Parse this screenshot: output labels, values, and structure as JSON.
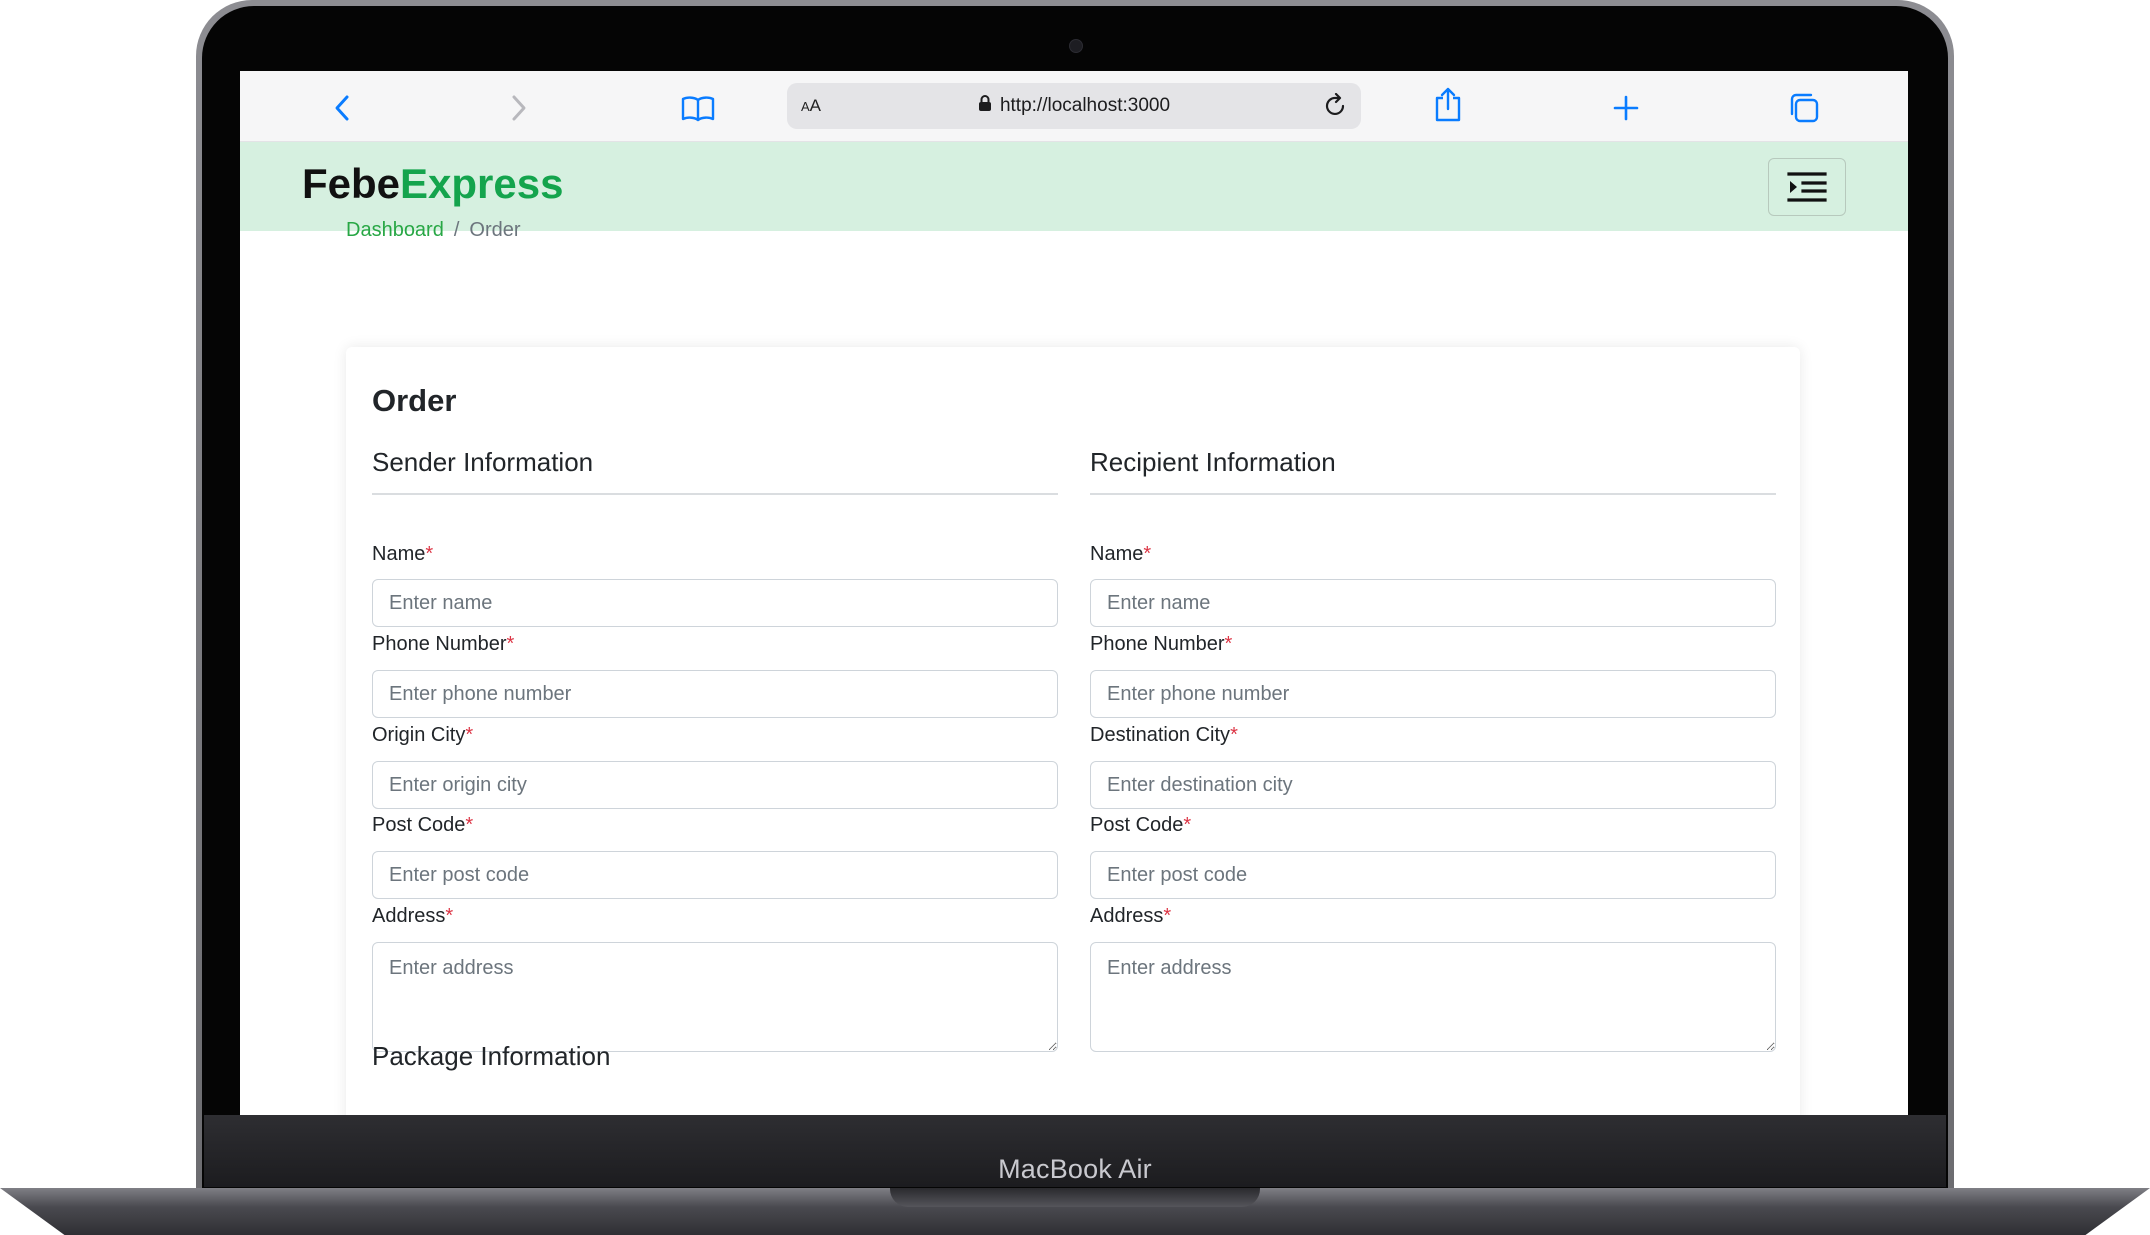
{
  "browser": {
    "text_size_button": "AA",
    "url": "http://localhost:3000"
  },
  "app": {
    "logo_prefix": "Febe",
    "logo_accent": "Express",
    "accent_color": "#14a44d",
    "header_bg": "#d6f0e0"
  },
  "breadcrumb": {
    "items": [
      "Dashboard",
      "Order"
    ],
    "separator": "/"
  },
  "page": {
    "title": "Order"
  },
  "sender": {
    "title": "Sender Information",
    "fields": [
      {
        "label": "Name",
        "required": "*",
        "placeholder": "Enter name",
        "value": ""
      },
      {
        "label": "Phone Number",
        "required": "*",
        "placeholder": "Enter phone number",
        "value": ""
      },
      {
        "label": "Origin City",
        "required": "*",
        "placeholder": "Enter origin city",
        "value": ""
      },
      {
        "label": "Post Code",
        "required": "*",
        "placeholder": "Enter post code",
        "value": ""
      },
      {
        "label": "Address",
        "required": "*",
        "placeholder": "Enter address",
        "value": ""
      }
    ]
  },
  "recipient": {
    "title": "Recipient Information",
    "fields": [
      {
        "label": "Name",
        "required": "*",
        "placeholder": "Enter name",
        "value": ""
      },
      {
        "label": "Phone Number",
        "required": "*",
        "placeholder": "Enter phone number",
        "value": ""
      },
      {
        "label": "Destination City",
        "required": "*",
        "placeholder": "Enter destination city",
        "value": ""
      },
      {
        "label": "Post Code",
        "required": "*",
        "placeholder": "Enter post code",
        "value": ""
      },
      {
        "label": "Address",
        "required": "*",
        "placeholder": "Enter address",
        "value": ""
      }
    ]
  },
  "package": {
    "title": "Package Information"
  },
  "device": {
    "label": "MacBook Air"
  },
  "icons": [
    "back-icon",
    "forward-icon",
    "bookmarks-icon",
    "lock-icon",
    "reload-icon",
    "share-icon",
    "new-tab-icon",
    "tabs-icon",
    "menu-toggle-icon"
  ]
}
